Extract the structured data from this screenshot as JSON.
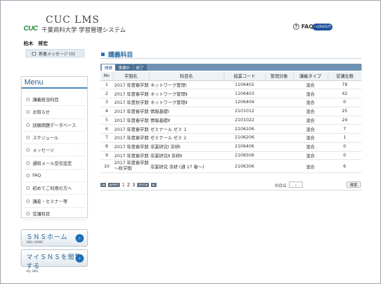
{
  "header": {
    "title": "CUC  LMS",
    "logo_text": "CUC",
    "subtitle": "千葉商科大学 学習管理システム",
    "faq_label": "FAQ",
    "faq_icon": "question-circle-icon",
    "logout_label": "› LOGOUT"
  },
  "user": {
    "name": "柏木　将宏",
    "new_message_label": "新着メッセージ (0)",
    "message_icon": "envelope-icon"
  },
  "menu": {
    "title": "Menu",
    "items": [
      {
        "label": "講義担当科目"
      },
      {
        "label": "お知らせ"
      },
      {
        "label": "試験問題データベース"
      },
      {
        "label": "スケジュール"
      },
      {
        "label": "メッセージ"
      },
      {
        "label": "通知メール受信設定"
      },
      {
        "label": "FAQ"
      },
      {
        "label": "初めてご利用の方へ"
      },
      {
        "label": "講座・セミナー等"
      },
      {
        "label": "受講科目"
      }
    ]
  },
  "sns": {
    "home": {
      "label": "ＳＮＳホーム",
      "sub": "SNS HOME"
    },
    "open": {
      "label": "マイＳＮＳを閲覧する",
      "sub": "My SNS"
    }
  },
  "main": {
    "page_title": "講義科目",
    "tabs": [
      {
        "label": "開講"
      },
      {
        "label": "準備中"
      },
      {
        "label": "終了"
      }
    ],
    "columns": [
      "No",
      "学期名",
      "科目名",
      "授業コード",
      "管理対象",
      "講義タイプ",
      "受講生数"
    ],
    "rows": [
      {
        "no": "1",
        "term": "2017 年度春学期",
        "course": "ネットワーク管理Ⅰ",
        "code": "1106402",
        "managed": "",
        "type": "混合",
        "count": "79"
      },
      {
        "no": "2",
        "term": "2017 年度春学期",
        "course": "ネットワーク管理Ⅱ",
        "code": "1106403",
        "managed": "",
        "type": "混合",
        "count": "42"
      },
      {
        "no": "3",
        "term": "2017 年度秋学期",
        "course": "ネットワーク管理Ⅱ",
        "code": "1206404",
        "managed": "",
        "type": "混合",
        "count": "0"
      },
      {
        "no": "4",
        "term": "2017 年度春学期",
        "course": "情報基礎Ⅰ",
        "code": "2101012",
        "managed": "",
        "type": "混合",
        "count": "25"
      },
      {
        "no": "5",
        "term": "2017 年度春学期",
        "course": "情報基礎Ⅱ",
        "code": "2101022",
        "managed": "",
        "type": "混合",
        "count": "24"
      },
      {
        "no": "6",
        "term": "2017 年度春学期",
        "course": "ゼミナール ゼミ 1",
        "code": "2106106",
        "managed": "",
        "type": "混合",
        "count": "7"
      },
      {
        "no": "7",
        "term": "2017 年度春学期",
        "course": "ゼミナール ゼミ 2",
        "code": "2106206",
        "managed": "",
        "type": "混合",
        "count": "1"
      },
      {
        "no": "8",
        "term": "2017 年度春学期",
        "course": "卒業研究Ⅰ 卒研Ⅰ",
        "code": "2106406",
        "managed": "",
        "type": "混合",
        "count": "0"
      },
      {
        "no": "9",
        "term": "2017 年度春学期",
        "course": "卒業研究Ⅱ 卒研Ⅱ",
        "code": "2106506",
        "managed": "",
        "type": "混合",
        "count": "0"
      },
      {
        "no": "10",
        "term": "2017 年度春学期～秋学期",
        "course": "卒業研究 卒研 (通 17 春～)",
        "code": "2106306",
        "managed": "",
        "type": "混合",
        "count": "6"
      }
    ],
    "pager": {
      "first": "|◀",
      "prev": "◀ PREV",
      "pages": [
        "1",
        "2",
        "3"
      ],
      "current": "1",
      "next": "NEXT ▶",
      "last": "▶|"
    },
    "sort_label": "科目名",
    "sort_value": "⌄",
    "search_label": "検索"
  }
}
